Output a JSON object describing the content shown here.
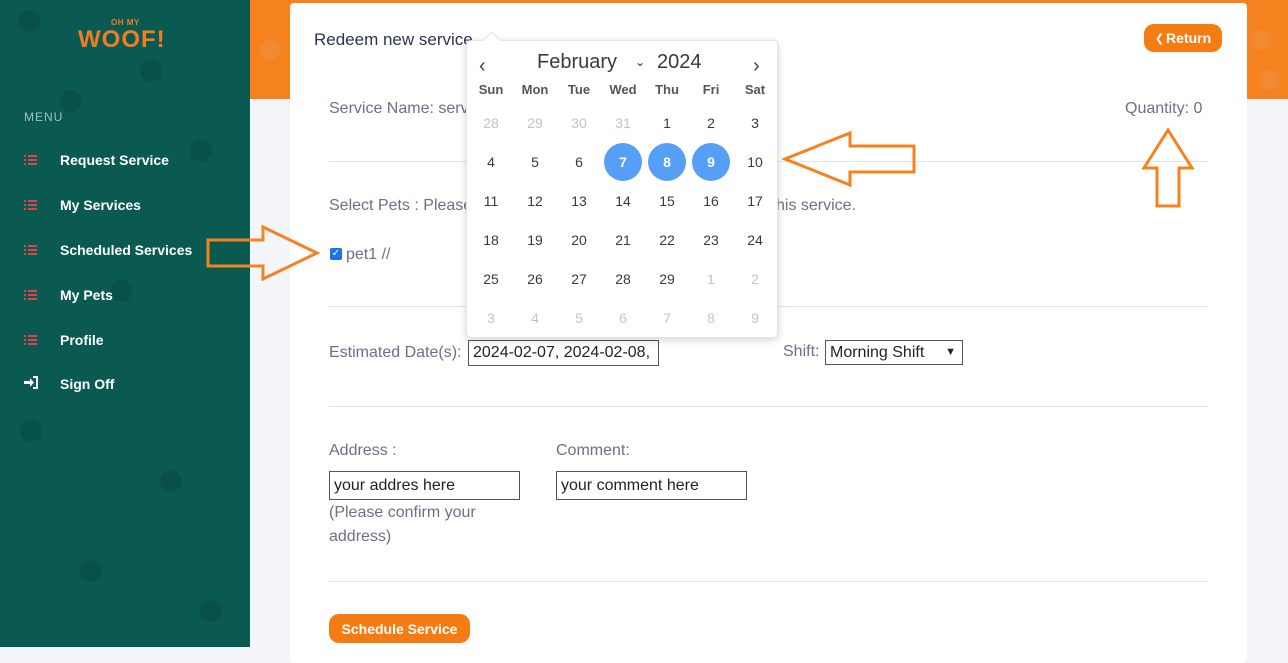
{
  "brand": {
    "logo_top": "OH MY",
    "logo_main": "WOOF!",
    "accent": "#f57c12",
    "sidebar_color": "#0b5a52"
  },
  "sidebar": {
    "menu_title": "MENU",
    "items": [
      {
        "label": "Request Service",
        "icon": "list-icon"
      },
      {
        "label": "My Services",
        "icon": "list-icon"
      },
      {
        "label": "Scheduled Services",
        "icon": "list-icon"
      },
      {
        "label": "My Pets",
        "icon": "list-icon"
      },
      {
        "label": "Profile",
        "icon": "list-icon"
      },
      {
        "label": "Sign Off",
        "icon": "sign-in-icon"
      }
    ]
  },
  "card": {
    "title": "Redeem new service",
    "return_label": "Return",
    "service_name": "Service Name: serv",
    "quantity": "Quantity: 0",
    "select_pets_left": "Select Pets : Please",
    "select_pets_right": "his service.",
    "pet_label": "pet1 //",
    "estimated_label": "Estimated Date(s):",
    "estimated_value": "2024-02-07, 2024-02-08,",
    "shift_label": "Shift:",
    "shift_value": "Morning Shift",
    "address_label": "Address :",
    "address_placeholder": "your addres here",
    "address_hint_1": "(Please confirm your",
    "address_hint_2": "address)",
    "comment_label": "Comment:",
    "comment_placeholder": "your comment here",
    "schedule_label": "Schedule Service"
  },
  "calendar": {
    "month": "February",
    "year": "2024",
    "weekdays": [
      "Sun",
      "Mon",
      "Tue",
      "Wed",
      "Thu",
      "Fri",
      "Sat"
    ],
    "weeks": [
      [
        "28",
        "29",
        "30",
        "31",
        "1",
        "2",
        "3"
      ],
      [
        "4",
        "5",
        "6",
        "7",
        "8",
        "9",
        "10"
      ],
      [
        "11",
        "12",
        "13",
        "14",
        "15",
        "16",
        "17"
      ],
      [
        "18",
        "19",
        "20",
        "21",
        "22",
        "23",
        "24"
      ],
      [
        "25",
        "26",
        "27",
        "28",
        "29",
        "1",
        "2"
      ],
      [
        "3",
        "4",
        "5",
        "6",
        "7",
        "8",
        "9"
      ]
    ],
    "selected": [
      "7",
      "8",
      "9"
    ],
    "selected_color": "#569ff7"
  }
}
